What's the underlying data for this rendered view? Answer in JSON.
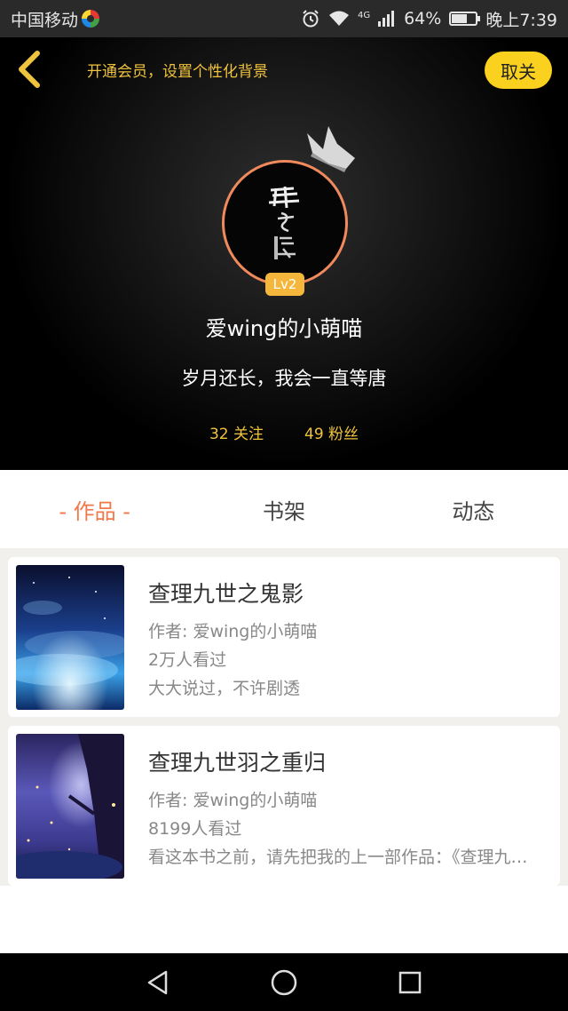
{
  "status_bar": {
    "carrier": "中国移动",
    "network": "4G",
    "battery": "64%",
    "battery_level": 0.64,
    "time": "晚上7:39"
  },
  "header": {
    "vip_prompt": "开通会员，设置个性化背景",
    "unfollow_label": "取关",
    "level": "Lv2",
    "username": "爱wing的小萌喵",
    "bio": "岁月还长，我会一直等唐",
    "following": "32 关注",
    "followers": "49 粉丝"
  },
  "tabs": [
    {
      "label": "- 作品 -",
      "active": true
    },
    {
      "label": "书架",
      "active": false
    },
    {
      "label": "动态",
      "active": false
    }
  ],
  "books": [
    {
      "title": "查理九世之鬼影",
      "author": "作者: 爱wing的小萌喵",
      "views": "2万人看过",
      "description": "大大说过，不许剧透"
    },
    {
      "title": "查理九世羽之重归",
      "author": "作者: 爱wing的小萌喵",
      "views": "8199人看过",
      "description": "看这本书之前，请先把我的上一部作品：《查理九世之鬼影》"
    }
  ],
  "colors": {
    "accent": "#f0784b",
    "gold": "#f0c33c",
    "button_yellow": "#fbd11f",
    "avatar_ring": "#f08a5d"
  }
}
